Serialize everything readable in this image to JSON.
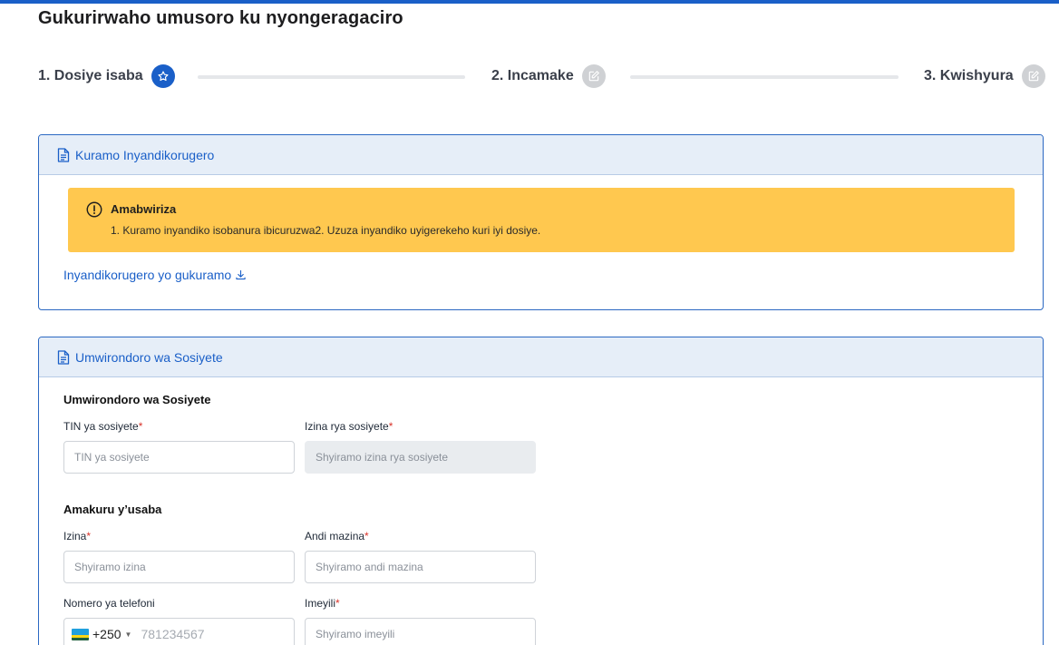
{
  "page": {
    "title": "Gukurirwaho umusoro ku nyongeragaciro"
  },
  "steps": [
    {
      "label": "1. Dosiye isaba",
      "icon": "star-icon",
      "state": "active"
    },
    {
      "label": "2. Incamake",
      "icon": "edit-icon",
      "state": "inactive"
    },
    {
      "label": "3. Kwishyura",
      "icon": "edit-icon",
      "state": "inactive"
    }
  ],
  "template_card": {
    "title": "Kuramo Inyandikorugero",
    "alert": {
      "title": "Amabwiriza",
      "text": "1. Kuramo inyandiko isobanura ibicuruzwa2. Uzuza inyandiko uyigerekeho kuri iyi dosiye."
    },
    "download_link": "Inyandikorugero yo gukuramo"
  },
  "company_card": {
    "title": "Umwirondoro wa Sosiyete",
    "company_section": {
      "title": "Umwirondoro wa Sosiyete",
      "tin_label": "TIN ya sosiyete",
      "tin_placeholder": "TIN ya sosiyete",
      "name_label": "Izina rya sosiyete",
      "name_placeholder": "Shyiramo izina rya sosiyete"
    },
    "applicant_section": {
      "title": "Amakuru y’usaba",
      "first_name_label": "Izina",
      "first_name_placeholder": "Shyiramo izina",
      "other_names_label": "Andi mazina",
      "other_names_placeholder": "Shyiramo andi mazina",
      "phone_label": "Nomero ya telefoni",
      "phone_code": "+250",
      "phone_placeholder": "781234567",
      "email_label": "Imeyili",
      "email_placeholder": "Shyiramo imeyili"
    }
  },
  "colors": {
    "accent": "#1a5fc8",
    "warning": "#ffc84f",
    "required": "#d9342b"
  }
}
